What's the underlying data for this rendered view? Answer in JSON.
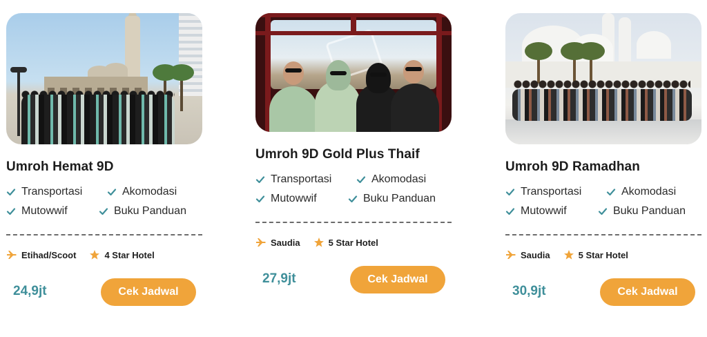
{
  "colors": {
    "accent": "#f0a43a",
    "price": "#3f8f9a",
    "check": "#3f8f9a"
  },
  "icons": {
    "check": "check-icon",
    "plane": "plane-icon",
    "star": "star-icon"
  },
  "packages": [
    {
      "title": "Umroh Hemat 9D",
      "features": [
        "Transportasi",
        "Akomodasi",
        "Mutowwif",
        "Buku Panduan"
      ],
      "airline": "Etihad/Scoot",
      "hotel": "4 Star Hotel",
      "price": "24,9jt",
      "button_label": "Cek Jadwal"
    },
    {
      "title": "Umroh 9D Gold Plus Thaif",
      "features": [
        "Transportasi",
        "Akomodasi",
        "Mutowwif",
        "Buku Panduan"
      ],
      "airline": "Saudia",
      "hotel": "5 Star Hotel",
      "price": "27,9jt",
      "button_label": "Cek Jadwal"
    },
    {
      "title": "Umroh 9D Ramadhan",
      "features": [
        "Transportasi",
        "Akomodasi",
        "Mutowwif",
        "Buku Panduan"
      ],
      "airline": "Saudia",
      "hotel": "5 Star Hotel",
      "price": "30,9jt",
      "button_label": "Cek Jadwal"
    }
  ]
}
